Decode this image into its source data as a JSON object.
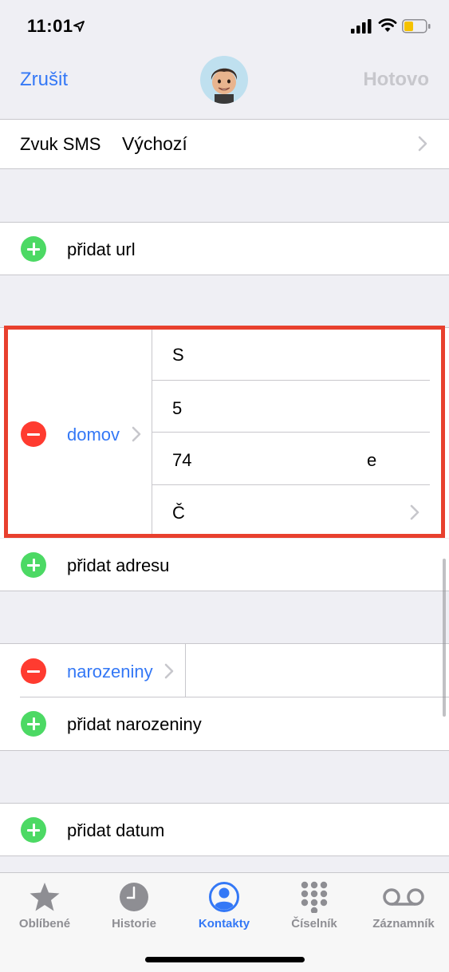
{
  "status": {
    "time": "11:01"
  },
  "nav": {
    "cancel": "Zrušit",
    "done": "Hotovo"
  },
  "sms": {
    "label": "Zvuk SMS",
    "value": "Výchozí"
  },
  "add_url": "přidat url",
  "address": {
    "label": "domov",
    "lines": [
      "S",
      "5",
      "74",
      "Č"
    ],
    "line3_suffix": "e"
  },
  "add_address": "přidat adresu",
  "birthday": {
    "label": "narozeniny"
  },
  "add_birthday": "přidat narozeniny",
  "add_date": "přidat datum",
  "tabs": [
    {
      "label": "Oblíbené",
      "icon": "star-icon"
    },
    {
      "label": "Historie",
      "icon": "clock-icon"
    },
    {
      "label": "Kontakty",
      "icon": "person-circle-icon",
      "active": true
    },
    {
      "label": "Číselník",
      "icon": "keypad-icon"
    },
    {
      "label": "Záznamník",
      "icon": "voicemail-icon"
    }
  ],
  "colors": {
    "accent": "#3478f6",
    "add": "#4cd964",
    "remove": "#ff3b30",
    "highlight": "#e8402e"
  }
}
